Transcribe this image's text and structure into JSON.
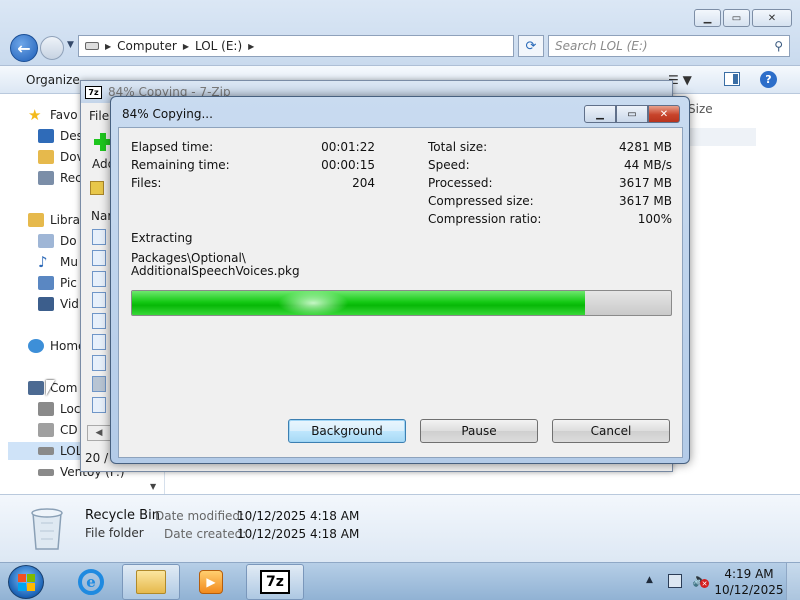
{
  "explorer": {
    "address": [
      "Computer",
      "LOL (E:)"
    ],
    "search_placeholder": "Search LOL (E:)",
    "organize": "Organize",
    "size_column": "Size",
    "nav": [
      {
        "label": "Favo",
        "icon": "star-icon",
        "color": "#f3b91a"
      },
      {
        "label": "Des",
        "icon": "desktop-icon",
        "color": "#2f6bb8"
      },
      {
        "label": "Dov",
        "icon": "downloads-icon",
        "color": "#e6b94c"
      },
      {
        "label": "Rec",
        "icon": "recent-places-icon",
        "color": "#7b8ea8"
      },
      {
        "label": "Libra",
        "icon": "libraries-icon",
        "color": "#e6b94c"
      },
      {
        "label": "Do",
        "icon": "documents-icon",
        "color": "#9fb6d6"
      },
      {
        "label": "Mu",
        "icon": "music-icon",
        "color": "#2f6bb8"
      },
      {
        "label": "Pic",
        "icon": "pictures-icon",
        "color": "#5a87c2"
      },
      {
        "label": "Vid",
        "icon": "videos-icon",
        "color": "#3c5e8c"
      },
      {
        "label": "Home",
        "icon": "homegroup-icon",
        "color": "#3d8fd8"
      },
      {
        "label": "Com",
        "icon": "computer-icon",
        "color": "#4c6a92"
      },
      {
        "label": "Loc",
        "icon": "local-disk-icon",
        "color": "#8a8a8a"
      },
      {
        "label": "CD",
        "icon": "cd-drive-icon",
        "color": "#a0a0a0"
      },
      {
        "label": "LOL",
        "icon": "drive-icon",
        "color": "#8a8a8a"
      },
      {
        "label": "Ventoy (F:)",
        "icon": "usb-drive-icon",
        "color": "#8a8a8a"
      }
    ],
    "details": {
      "name": "Recycle Bin",
      "type": "File folder",
      "modified_label": "Date modified:",
      "modified_value": "10/12/2025 4:18 AM",
      "created_label": "Date created:",
      "created_value": "10/12/2025 4:18 AM"
    }
  },
  "zip_main": {
    "title": "84% Copying - 7-Zip",
    "menu": "File",
    "add_label": "Add",
    "name_column": "Nar",
    "status": "20 / 2"
  },
  "dialog": {
    "title": "84% Copying...",
    "left_stats": [
      {
        "label": "Elapsed time:",
        "value": "00:01:22"
      },
      {
        "label": "Remaining time:",
        "value": "00:00:15"
      },
      {
        "label": "Files:",
        "value": "204"
      }
    ],
    "right_stats": [
      {
        "label": "Total size:",
        "value": "4281 MB"
      },
      {
        "label": "Speed:",
        "value": "44 MB/s"
      },
      {
        "label": "Processed:",
        "value": "3617 MB"
      },
      {
        "label": "Compressed size:",
        "value": "3617 MB"
      },
      {
        "label": "Compression ratio:",
        "value": "100%"
      }
    ],
    "operation": "Extracting",
    "path_line1": "Packages\\Optional\\",
    "path_line2": "AdditionalSpeechVoices.pkg",
    "progress": 0.84,
    "buttons": {
      "background": "Background",
      "pause": "Pause",
      "cancel": "Cancel"
    }
  },
  "taskbar": {
    "time": "4:19 AM",
    "date": "10/12/2025"
  }
}
